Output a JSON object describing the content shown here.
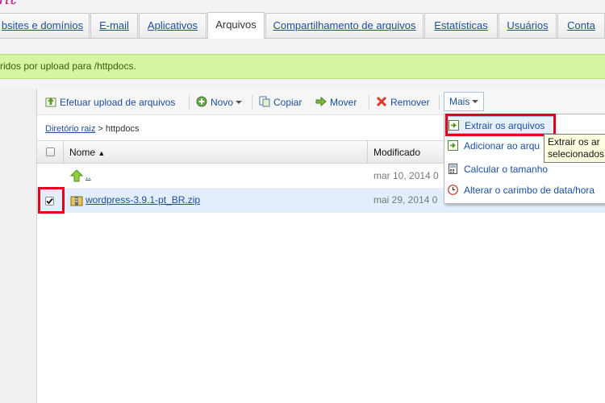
{
  "logo": {
    "fragment": "nt"
  },
  "tabs": [
    {
      "label": "bsites e domínios"
    },
    {
      "label": "E-mail"
    },
    {
      "label": "Aplicativos"
    },
    {
      "label": "Arquivos",
      "active": true
    },
    {
      "label": "Compartilhamento de arquivos"
    },
    {
      "label": "Estatísticas"
    },
    {
      "label": "Usuários"
    },
    {
      "label": "Conta"
    }
  ],
  "message": {
    "text": "ridos por upload para /httpdocs."
  },
  "toolbar": {
    "upload_label": "Efetuar upload de arquivos",
    "new_label": "Novo",
    "copy_label": "Copiar",
    "move_label": "Mover",
    "remove_label": "Remover",
    "more_label": "Mais"
  },
  "breadcrumb": {
    "root": "Diretório raiz",
    "separator": ">",
    "current": "httpdocs"
  },
  "table": {
    "columns": {
      "name": "Nome",
      "modified": "Modificado"
    },
    "rows": [
      {
        "name": "..",
        "modified": "mar 10, 2014 0",
        "selected": false
      },
      {
        "name": "wordpress-3.9.1-pt_BR.zip",
        "modified": "mai 29, 2014 0",
        "selected": true
      }
    ]
  },
  "menu": {
    "items": [
      {
        "label": "Extrair os arquivos",
        "icon": "extract-icon"
      },
      {
        "label": "Adicionar ao arqu",
        "icon": "archive-add-icon"
      },
      {
        "label": "Calcular o tamanho",
        "icon": "calculator-icon"
      },
      {
        "label": "Alterar o carimbo de data/hora",
        "icon": "clock-icon"
      }
    ]
  },
  "tooltip": {
    "line1": "Extrair os ar",
    "line2": "selecionados"
  },
  "colors": {
    "accent": "#1c4fa0",
    "highlight_red": "#e4001b",
    "message_bg": "#d6f5a3"
  }
}
